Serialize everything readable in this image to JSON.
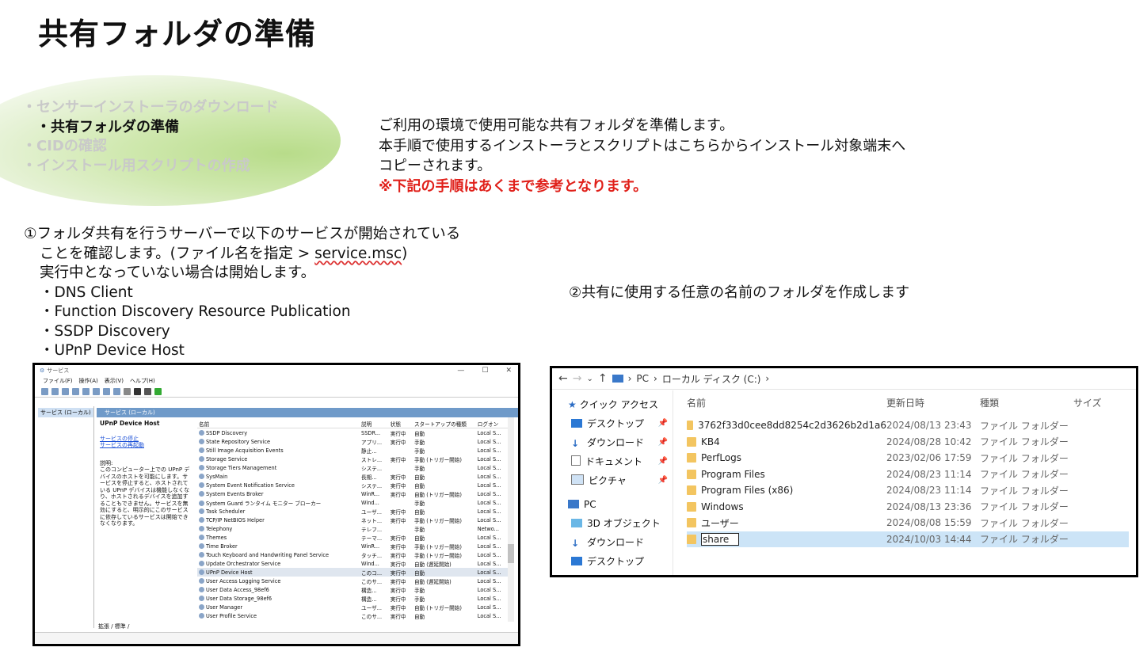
{
  "title": "共有フォルダの準備",
  "nav": {
    "item1": "・センサーインストーラのダウンロード",
    "item2": "・共有フォルダの準備",
    "item3": "・CIDの確認",
    "item4": "・インストール用スクリプトの作成"
  },
  "intro": {
    "line1": "ご利用の環境で使用可能な共有フォルダを準備します。",
    "line2": "本手順で使用するインストーラとスクリプトはこちらからインストール対象端末へ",
    "line3": "コピーされます。",
    "warning": "※下記の手順はあくまで参考となります。"
  },
  "step1": {
    "line1": "①フォルダ共有を行うサーバーで以下のサービスが開始されている",
    "line2a": "ことを確認します。(ファイル名を指定 > ",
    "line2b": "service.msc",
    "line2c": ")",
    "line3": "実行中となっていない場合は開始します。",
    "items": [
      "・DNS Client",
      "・Function Discovery Resource Publication",
      "・SSDP Discovery",
      "・UPnP Device Host"
    ]
  },
  "step2": "②共有に使用する任意の名前のフォルダを作成します",
  "services_window": {
    "title": "サービス",
    "menu": [
      "ファイル(F)",
      "操作(A)",
      "表示(V)",
      "ヘルプ(H)"
    ],
    "left_item": "サービス (ローカル)",
    "header": "サービス (ローカル)",
    "selected_service": "UPnP Device Host",
    "link_stop": "サービスの停止",
    "link_restart": "サービスの再起動",
    "description": "説明:\nこのコンピューター上での UPnP デバイスのホストを可能にします。サービスを停止すると、ホストされている UPnP デバイスは機能しなくなり、ホストされるデバイスを追加することもできません。サービスを無効にすると、明示的にこのサービスに依存しているサービスは開始できなくなります。",
    "columns": [
      "名前",
      "説明",
      "状態",
      "スタートアップの種類",
      "ログオン"
    ],
    "rows": [
      [
        "SSDP Discovery",
        "SSDR...",
        "実行中",
        "自動",
        "Local S..."
      ],
      [
        "State Repository Service",
        "アプリ...",
        "実行中",
        "手動",
        "Local S..."
      ],
      [
        "Still Image Acquisition Events",
        "静止...",
        "",
        "手動",
        "Local S..."
      ],
      [
        "Storage Service",
        "ストレ...",
        "実行中",
        "手動 (トリガー開始)",
        "Local S..."
      ],
      [
        "Storage Tiers Management",
        "システ...",
        "",
        "手動",
        "Local S..."
      ],
      [
        "SysMain",
        "長期...",
        "実行中",
        "自動",
        "Local S..."
      ],
      [
        "System Event Notification Service",
        "システ...",
        "実行中",
        "自動",
        "Local S..."
      ],
      [
        "System Events Broker",
        "WinR...",
        "実行中",
        "自動 (トリガー開始)",
        "Local S..."
      ],
      [
        "System Guard ランタイム モニター ブローカー",
        "Wind...",
        "",
        "手動",
        "Local S..."
      ],
      [
        "Task Scheduler",
        "ユーザ...",
        "実行中",
        "自動",
        "Local S..."
      ],
      [
        "TCP/IP NetBIOS Helper",
        "ネット...",
        "実行中",
        "手動 (トリガー開始)",
        "Local S..."
      ],
      [
        "Telephony",
        "テレフ...",
        "",
        "手動",
        "Netwo..."
      ],
      [
        "Themes",
        "テーマ...",
        "実行中",
        "自動",
        "Local S..."
      ],
      [
        "Time Broker",
        "WinR...",
        "実行中",
        "手動 (トリガー開始)",
        "Local S..."
      ],
      [
        "Touch Keyboard and Handwriting Panel Service",
        "タッチ...",
        "実行中",
        "手動 (トリガー開始)",
        "Local S..."
      ],
      [
        "Update Orchestrator Service",
        "Wind...",
        "実行中",
        "自動 (遅延開始)",
        "Local S..."
      ],
      [
        "UPnP Device Host",
        "このコ...",
        "実行中",
        "自動",
        "Local S..."
      ],
      [
        "User Access Logging Service",
        "このサ...",
        "実行中",
        "自動 (遅延開始)",
        "Local S..."
      ],
      [
        "User Data Access_98ef6",
        "構造...",
        "実行中",
        "手動",
        "Local S..."
      ],
      [
        "User Data Storage_98ef6",
        "構造...",
        "実行中",
        "手動",
        "Local S..."
      ],
      [
        "User Manager",
        "ユーザ...",
        "実行中",
        "自動 (トリガー開始)",
        "Local S..."
      ],
      [
        "User Profile Service",
        "このサ...",
        "実行中",
        "自動",
        "Local S..."
      ]
    ],
    "tabs": "拡張 / 標準 /"
  },
  "explorer": {
    "path": [
      "PC",
      "ローカル ディスク (C:)"
    ],
    "nav_items": [
      "クイック アクセス",
      "デスクトップ",
      "ダウンロード",
      "ドキュメント",
      "ピクチャ",
      "PC",
      "3D オブジェクト",
      "ダウンロード",
      "デスクトップ"
    ],
    "columns": [
      "名前",
      "更新日時",
      "種類",
      "サイズ"
    ],
    "rows": [
      [
        "3762f33d0cee8dd8254c2d3626b2d1a6",
        "2024/08/13 23:43",
        "ファイル フォルダー"
      ],
      [
        "KB4",
        "2024/08/28 10:42",
        "ファイル フォルダー"
      ],
      [
        "PerfLogs",
        "2023/02/06 17:59",
        "ファイル フォルダー"
      ],
      [
        "Program Files",
        "2024/08/23 11:14",
        "ファイル フォルダー"
      ],
      [
        "Program Files (x86)",
        "2024/08/23 11:14",
        "ファイル フォルダー"
      ],
      [
        "Windows",
        "2024/08/13 23:36",
        "ファイル フォルダー"
      ],
      [
        "ユーザー",
        "2024/08/08 15:59",
        "ファイル フォルダー"
      ],
      [
        "share",
        "2024/10/03 14:44",
        "ファイル フォルダー"
      ]
    ]
  }
}
